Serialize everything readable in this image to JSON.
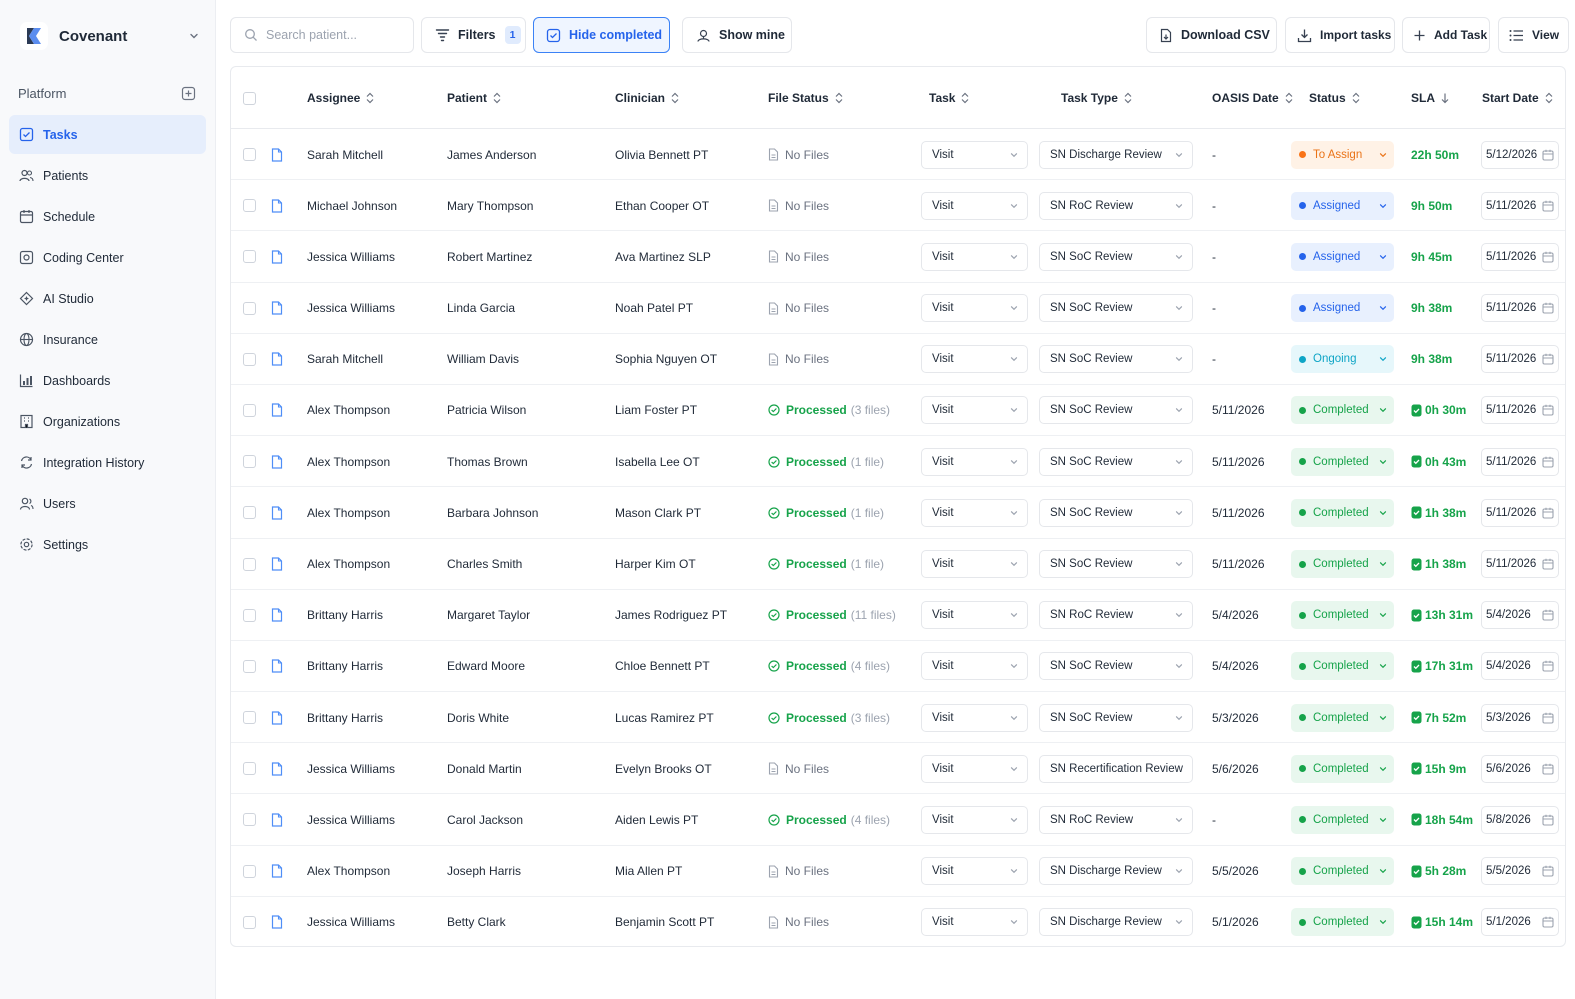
{
  "brand": {
    "name": "Covenant"
  },
  "sidebar": {
    "section_label": "Platform",
    "items": [
      {
        "label": "Tasks",
        "icon": "tasks-icon",
        "active": true
      },
      {
        "label": "Patients",
        "icon": "users-icon",
        "active": false
      },
      {
        "label": "Schedule",
        "icon": "calendar-icon",
        "active": false
      },
      {
        "label": "Coding Center",
        "icon": "code-icon",
        "active": false
      },
      {
        "label": "AI Studio",
        "icon": "sparkle-icon",
        "active": false
      },
      {
        "label": "Insurance",
        "icon": "globe-icon",
        "active": false
      },
      {
        "label": "Dashboards",
        "icon": "chart-icon",
        "active": false
      },
      {
        "label": "Organizations",
        "icon": "building-icon",
        "active": false
      },
      {
        "label": "Integration History",
        "icon": "sync-icon",
        "active": false
      },
      {
        "label": "Users",
        "icon": "user-icon",
        "active": false
      },
      {
        "label": "Settings",
        "icon": "gear-icon",
        "active": false
      }
    ]
  },
  "toolbar": {
    "search_placeholder": "Search patient...",
    "filters_label": "Filters",
    "filters_count": "1",
    "hide_completed_label": "Hide completed",
    "show_mine_label": "Show mine",
    "download_csv_label": "Download CSV",
    "import_tasks_label": "Import tasks",
    "add_task_label": "Add Task",
    "view_label": "View"
  },
  "table": {
    "columns": [
      "Assignee",
      "Patient",
      "Clinician",
      "File Status",
      "Task",
      "Task Type",
      "OASIS Date",
      "Status",
      "SLA",
      "Start Date"
    ],
    "rows": [
      {
        "assignee": "Sarah Mitchell",
        "patient": "James Anderson",
        "clinician": "Olivia Bennett PT",
        "file_status": "No Files",
        "files_count": "",
        "task": "Visit",
        "task_type": "SN Discharge Review",
        "oasis_date": "-",
        "status": "To Assign",
        "sla": "22h 50m",
        "start_date": "5/12/2026"
      },
      {
        "assignee": "Michael Johnson",
        "patient": "Mary Thompson",
        "clinician": "Ethan Cooper OT",
        "file_status": "No Files",
        "files_count": "",
        "task": "Visit",
        "task_type": "SN RoC Review",
        "oasis_date": "-",
        "status": "Assigned",
        "sla": "9h 50m",
        "start_date": "5/11/2026"
      },
      {
        "assignee": "Jessica Williams",
        "patient": "Robert Martinez",
        "clinician": "Ava Martinez SLP",
        "file_status": "No Files",
        "files_count": "",
        "task": "Visit",
        "task_type": "SN SoC Review",
        "oasis_date": "-",
        "status": "Assigned",
        "sla": "9h 45m",
        "start_date": "5/11/2026"
      },
      {
        "assignee": "Jessica Williams",
        "patient": "Linda Garcia",
        "clinician": "Noah Patel PT",
        "file_status": "No Files",
        "files_count": "",
        "task": "Visit",
        "task_type": "SN SoC Review",
        "oasis_date": "-",
        "status": "Assigned",
        "sla": "9h 38m",
        "start_date": "5/11/2026"
      },
      {
        "assignee": "Sarah Mitchell",
        "patient": "William Davis",
        "clinician": "Sophia Nguyen OT",
        "file_status": "No Files",
        "files_count": "",
        "task": "Visit",
        "task_type": "SN SoC Review",
        "oasis_date": "-",
        "status": "Ongoing",
        "sla": "9h 38m",
        "start_date": "5/11/2026"
      },
      {
        "assignee": "Alex Thompson",
        "patient": "Patricia Wilson",
        "clinician": "Liam Foster PT",
        "file_status": "Processed",
        "files_count": "(3 files)",
        "task": "Visit",
        "task_type": "SN SoC Review",
        "oasis_date": "5/11/2026",
        "status": "Completed",
        "sla": "0h 30m",
        "start_date": "5/11/2026"
      },
      {
        "assignee": "Alex Thompson",
        "patient": "Thomas Brown",
        "clinician": "Isabella Lee OT",
        "file_status": "Processed",
        "files_count": "(1 file)",
        "task": "Visit",
        "task_type": "SN SoC Review",
        "oasis_date": "5/11/2026",
        "status": "Completed",
        "sla": "0h 43m",
        "start_date": "5/11/2026"
      },
      {
        "assignee": "Alex Thompson",
        "patient": "Barbara Johnson",
        "clinician": "Mason Clark PT",
        "file_status": "Processed",
        "files_count": "(1 file)",
        "task": "Visit",
        "task_type": "SN SoC Review",
        "oasis_date": "5/11/2026",
        "status": "Completed",
        "sla": "1h 38m",
        "start_date": "5/11/2026"
      },
      {
        "assignee": "Alex Thompson",
        "patient": "Charles Smith",
        "clinician": "Harper Kim OT",
        "file_status": "Processed",
        "files_count": "(1 file)",
        "task": "Visit",
        "task_type": "SN SoC Review",
        "oasis_date": "5/11/2026",
        "status": "Completed",
        "sla": "1h 38m",
        "start_date": "5/11/2026"
      },
      {
        "assignee": "Brittany Harris",
        "patient": "Margaret Taylor",
        "clinician": "James Rodriguez PT",
        "file_status": "Processed",
        "files_count": "(11 files)",
        "task": "Visit",
        "task_type": "SN RoC Review",
        "oasis_date": "5/4/2026",
        "status": "Completed",
        "sla": "13h 31m",
        "start_date": "5/4/2026"
      },
      {
        "assignee": "Brittany Harris",
        "patient": "Edward Moore",
        "clinician": "Chloe Bennett PT",
        "file_status": "Processed",
        "files_count": "(4 files)",
        "task": "Visit",
        "task_type": "SN SoC Review",
        "oasis_date": "5/4/2026",
        "status": "Completed",
        "sla": "17h 31m",
        "start_date": "5/4/2026"
      },
      {
        "assignee": "Brittany Harris",
        "patient": "Doris White",
        "clinician": "Lucas Ramirez PT",
        "file_status": "Processed",
        "files_count": "(3 files)",
        "task": "Visit",
        "task_type": "SN SoC Review",
        "oasis_date": "5/3/2026",
        "status": "Completed",
        "sla": "7h 52m",
        "start_date": "5/3/2026"
      },
      {
        "assignee": "Jessica Williams",
        "patient": "Donald Martin",
        "clinician": "Evelyn Brooks OT",
        "file_status": "No Files",
        "files_count": "",
        "task": "Visit",
        "task_type": "SN Recertification Review",
        "oasis_date": "5/6/2026",
        "status": "Completed",
        "sla": "15h 9m",
        "start_date": "5/6/2026"
      },
      {
        "assignee": "Jessica Williams",
        "patient": "Carol Jackson",
        "clinician": "Aiden Lewis PT",
        "file_status": "Processed",
        "files_count": "(4 files)",
        "task": "Visit",
        "task_type": "SN RoC Review",
        "oasis_date": "-",
        "status": "Completed",
        "sla": "18h 54m",
        "start_date": "5/8/2026"
      },
      {
        "assignee": "Alex Thompson",
        "patient": "Joseph Harris",
        "clinician": "Mia Allen PT",
        "file_status": "No Files",
        "files_count": "",
        "task": "Visit",
        "task_type": "SN Discharge Review",
        "oasis_date": "5/5/2026",
        "status": "Completed",
        "sla": "5h 28m",
        "start_date": "5/5/2026"
      },
      {
        "assignee": "Jessica Williams",
        "patient": "Betty Clark",
        "clinician": "Benjamin Scott PT",
        "file_status": "No Files",
        "files_count": "",
        "task": "Visit",
        "task_type": "SN Discharge Review",
        "oasis_date": "5/1/2026",
        "status": "Completed",
        "sla": "15h 14m",
        "start_date": "5/1/2026"
      }
    ]
  },
  "colors": {
    "accent": "#2563eb",
    "success": "#16a34a",
    "warning": "#f97316",
    "info": "#0ea5c6"
  }
}
